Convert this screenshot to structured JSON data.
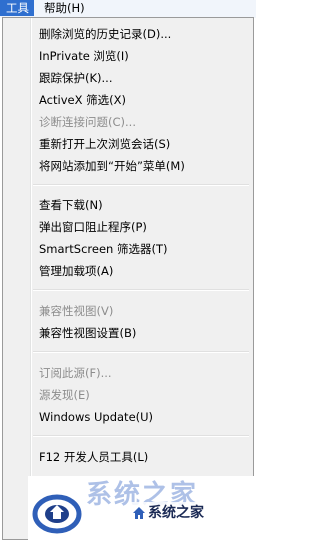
{
  "menubar": {
    "tools": "工具(T)",
    "help": "帮助(H)"
  },
  "menu": {
    "items": [
      {
        "label": "删除浏览的历史记录(D)...",
        "disabled": false
      },
      {
        "label": "InPrivate 浏览(I)",
        "disabled": false
      },
      {
        "label": "跟踪保护(K)...",
        "disabled": false
      },
      {
        "label": "ActiveX 筛选(X)",
        "disabled": false
      },
      {
        "label": "诊断连接问题(C)...",
        "disabled": true
      },
      {
        "label": "重新打开上次浏览会话(S)",
        "disabled": false
      },
      {
        "label": "将网站添加到“开始”菜单(M)",
        "disabled": false
      },
      {
        "label": "查看下载(N)",
        "disabled": false
      },
      {
        "label": "弹出窗口阻止程序(P)",
        "disabled": false
      },
      {
        "label": "SmartScreen 筛选器(T)",
        "disabled": false
      },
      {
        "label": "管理加载项(A)",
        "disabled": false
      },
      {
        "label": "兼容性视图(V)",
        "disabled": true
      },
      {
        "label": "兼容性视图设置(B)",
        "disabled": false
      },
      {
        "label": "订阅此源(F)...",
        "disabled": true
      },
      {
        "label": "源发现(E)",
        "disabled": true
      },
      {
        "label": "Windows Update(U)",
        "disabled": false
      },
      {
        "label": "F12 开发人员工具(L)",
        "disabled": false
      }
    ]
  },
  "watermark": {
    "big_text": "系统之家",
    "badge_text": "系统之家"
  },
  "colors": {
    "menubar_active": "#2f6fcf",
    "disabled_text": "#8d8d8d"
  }
}
